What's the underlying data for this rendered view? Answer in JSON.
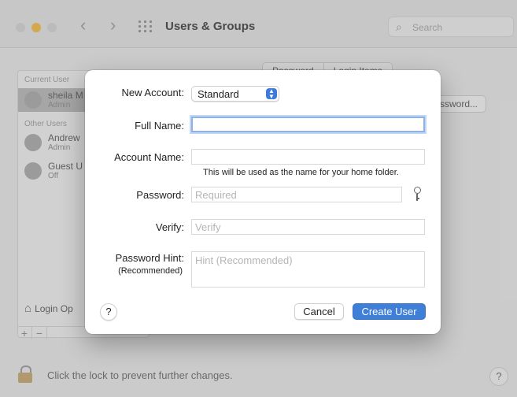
{
  "window": {
    "title": "Users & Groups",
    "search_placeholder": "Search"
  },
  "sidebar": {
    "current_header": "Current User",
    "current_user": {
      "name": "sheila M",
      "role": "Admin"
    },
    "other_header": "Other Users",
    "users": [
      {
        "name": "Andrew",
        "role": "Admin"
      },
      {
        "name": "Guest U",
        "role": "Off"
      }
    ],
    "login_options": "Login Op",
    "add": "+",
    "remove": "−"
  },
  "tabs": [
    "Password",
    "Login Items"
  ],
  "change_password_label": "ssword...",
  "footer": {
    "lock_text": "Click the lock to prevent further changes.",
    "help": "?"
  },
  "sheet": {
    "new_account_label": "New Account:",
    "new_account_value": "Standard",
    "full_name_label": "Full Name:",
    "full_name_value": "",
    "account_name_label": "Account Name:",
    "account_name_value": "",
    "account_name_note": "This will be used as the name for your home folder.",
    "password_label": "Password:",
    "password_placeholder": "Required",
    "verify_label": "Verify:",
    "verify_placeholder": "Verify",
    "hint_label": "Password Hint:",
    "hint_sublabel": "(Recommended)",
    "hint_placeholder": "Hint (Recommended)",
    "help": "?",
    "cancel": "Cancel",
    "create": "Create User"
  },
  "colors": {
    "accent": "#3f7fd8",
    "focus_ring": "#8eb2e3",
    "traffic_red": "#d8d8d8",
    "traffic_yellow": "#f5bd3e",
    "traffic_green": "#d8d8d8"
  }
}
